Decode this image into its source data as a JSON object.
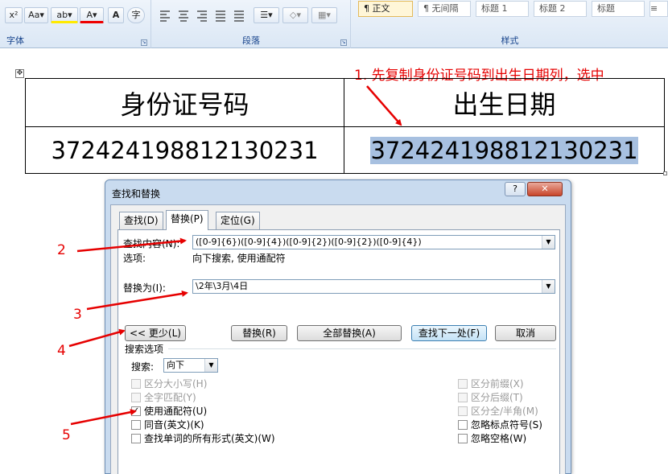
{
  "ribbon": {
    "font_group_label": "字体",
    "font_buttons": [
      "x²",
      "Aa▾",
      "ab▾",
      "A▾",
      "A",
      "字"
    ],
    "paragraph_group_label": "段落",
    "styles_group_label": "样式",
    "styles": [
      "¶ 正文",
      "¶ 无间隔",
      "标题 1",
      "标题 2",
      "标题"
    ]
  },
  "document": {
    "annotation1": "1. 先复制身份证号码到出生日期列，选中",
    "table": {
      "headers": [
        "身份证号码",
        "出生日期"
      ],
      "values": [
        "372424198812130231",
        "372424198812130231"
      ]
    },
    "step_labels": [
      "2",
      "3",
      "4",
      "5"
    ]
  },
  "dialog": {
    "title": "查找和替换",
    "help_label": "?",
    "close_label": "✕",
    "tabs": [
      "查找(D)",
      "替换(P)",
      "定位(G)"
    ],
    "active_tab": "替换(P)",
    "find_label": "查找内容(N):",
    "find_value": "([0-9]{6})([0-9]{4})([0-9]{2})([0-9]{2})([0-9]{4})",
    "options_label": "选项:",
    "options_value": "向下搜索, 使用通配符",
    "replace_label": "替换为(I):",
    "replace_value": "\\2年\\3月\\4日",
    "buttons": {
      "less": "<< 更少(L)",
      "replace": "替换(R)",
      "replace_all": "全部替换(A)",
      "find_next": "查找下一处(F)",
      "cancel": "取消"
    },
    "search_options_title": "搜索选项",
    "search_label": "搜索:",
    "search_value": "向下",
    "left_options": [
      {
        "label": "区分大小写(H)",
        "checked": false,
        "enabled": false
      },
      {
        "label": "全字匹配(Y)",
        "checked": false,
        "enabled": false
      },
      {
        "label": "使用通配符(U)",
        "checked": true,
        "enabled": true
      },
      {
        "label": "同音(英文)(K)",
        "checked": false,
        "enabled": true
      },
      {
        "label": "查找单词的所有形式(英文)(W)",
        "checked": false,
        "enabled": true
      }
    ],
    "right_options": [
      {
        "label": "区分前缀(X)",
        "checked": false,
        "enabled": false
      },
      {
        "label": "区分后缀(T)",
        "checked": false,
        "enabled": false
      },
      {
        "label": "区分全/半角(M)",
        "checked": false,
        "enabled": false
      },
      {
        "label": "忽略标点符号(S)",
        "checked": false,
        "enabled": true
      },
      {
        "label": "忽略空格(W)",
        "checked": false,
        "enabled": true
      }
    ]
  },
  "colors": {
    "annotation_red": "#e60000",
    "selection": "#a7c0e0",
    "ribbon": "#dbe7f5"
  }
}
